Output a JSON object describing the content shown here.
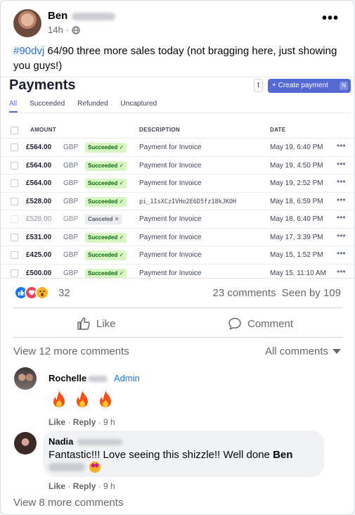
{
  "post": {
    "author": "Ben",
    "time": "14h",
    "visibility_icon": "globe-icon",
    "hashtag": "#90dvj",
    "text": " 64/90 three more sales today (not bragging here, just showing you guys!)"
  },
  "payments": {
    "title": "Payments",
    "t_key": "t",
    "create_label": "+ Create payment",
    "create_shortcut": "N",
    "tabs": [
      "All",
      "Succeeded",
      "Refunded",
      "Uncaptured"
    ],
    "columns": {
      "amount": "AMOUNT",
      "description": "DESCRIPTION",
      "date": "DATE"
    },
    "rows": [
      {
        "amount": "£564.00",
        "currency": "GBP",
        "status": "Succeeded ✓",
        "description": "Payment for Invoice",
        "date": "May 19, 6:40 PM"
      },
      {
        "amount": "£564.00",
        "currency": "GBP",
        "status": "Succeeded ✓",
        "description": "Payment for Invoice",
        "date": "May 19, 4:50 PM"
      },
      {
        "amount": "£564.00",
        "currency": "GBP",
        "status": "Succeeded ✓",
        "description": "Payment for Invoice",
        "date": "May 19, 2:52 PM"
      },
      {
        "amount": "£528.00",
        "currency": "GBP",
        "status": "Succeeded ✓",
        "description": "pi_1IsXCzIVHo2E6D5fz18kJKOH",
        "date": "May 18, 6:59 PM"
      },
      {
        "amount": "£528.00",
        "currency": "GBP",
        "status": "Canceled ✕",
        "description": "Payment for Invoice",
        "date": "May 18, 6:40 PM"
      },
      {
        "amount": "£531.00",
        "currency": "GBP",
        "status": "Succeeded ✓",
        "description": "Payment for Invoice",
        "date": "May 17, 3:39 PM"
      },
      {
        "amount": "£425.00",
        "currency": "GBP",
        "status": "Succeeded ✓",
        "description": "Payment for Invoice",
        "date": "May 15, 1:52 PM"
      },
      {
        "amount": "£500.00",
        "currency": "GBP",
        "status": "Succeeded ✓",
        "description": "Payment for Invoice",
        "date": "May 15, 11:10 AM"
      }
    ],
    "row_menu": "•••"
  },
  "reactions": {
    "count": "32",
    "comments": "23 comments",
    "seen": "Seen by 109"
  },
  "actions": {
    "like": "Like",
    "comment": "Comment"
  },
  "comments_section": {
    "view_more": "View 12 more comments",
    "filter": "All comments",
    "view_more_bottom": "View 8 more comments"
  },
  "comments": [
    {
      "name": "Rochelle",
      "badge": "Admin",
      "like": "Like",
      "reply": "Reply",
      "time": "9 h"
    },
    {
      "name": "Nadia",
      "text": "Fantastic!!! Love seeing this shizzle!! Well done ",
      "mention": "Ben",
      "like": "Like",
      "reply": "Reply",
      "time": "9 h"
    }
  ],
  "more_icon": "•••"
}
